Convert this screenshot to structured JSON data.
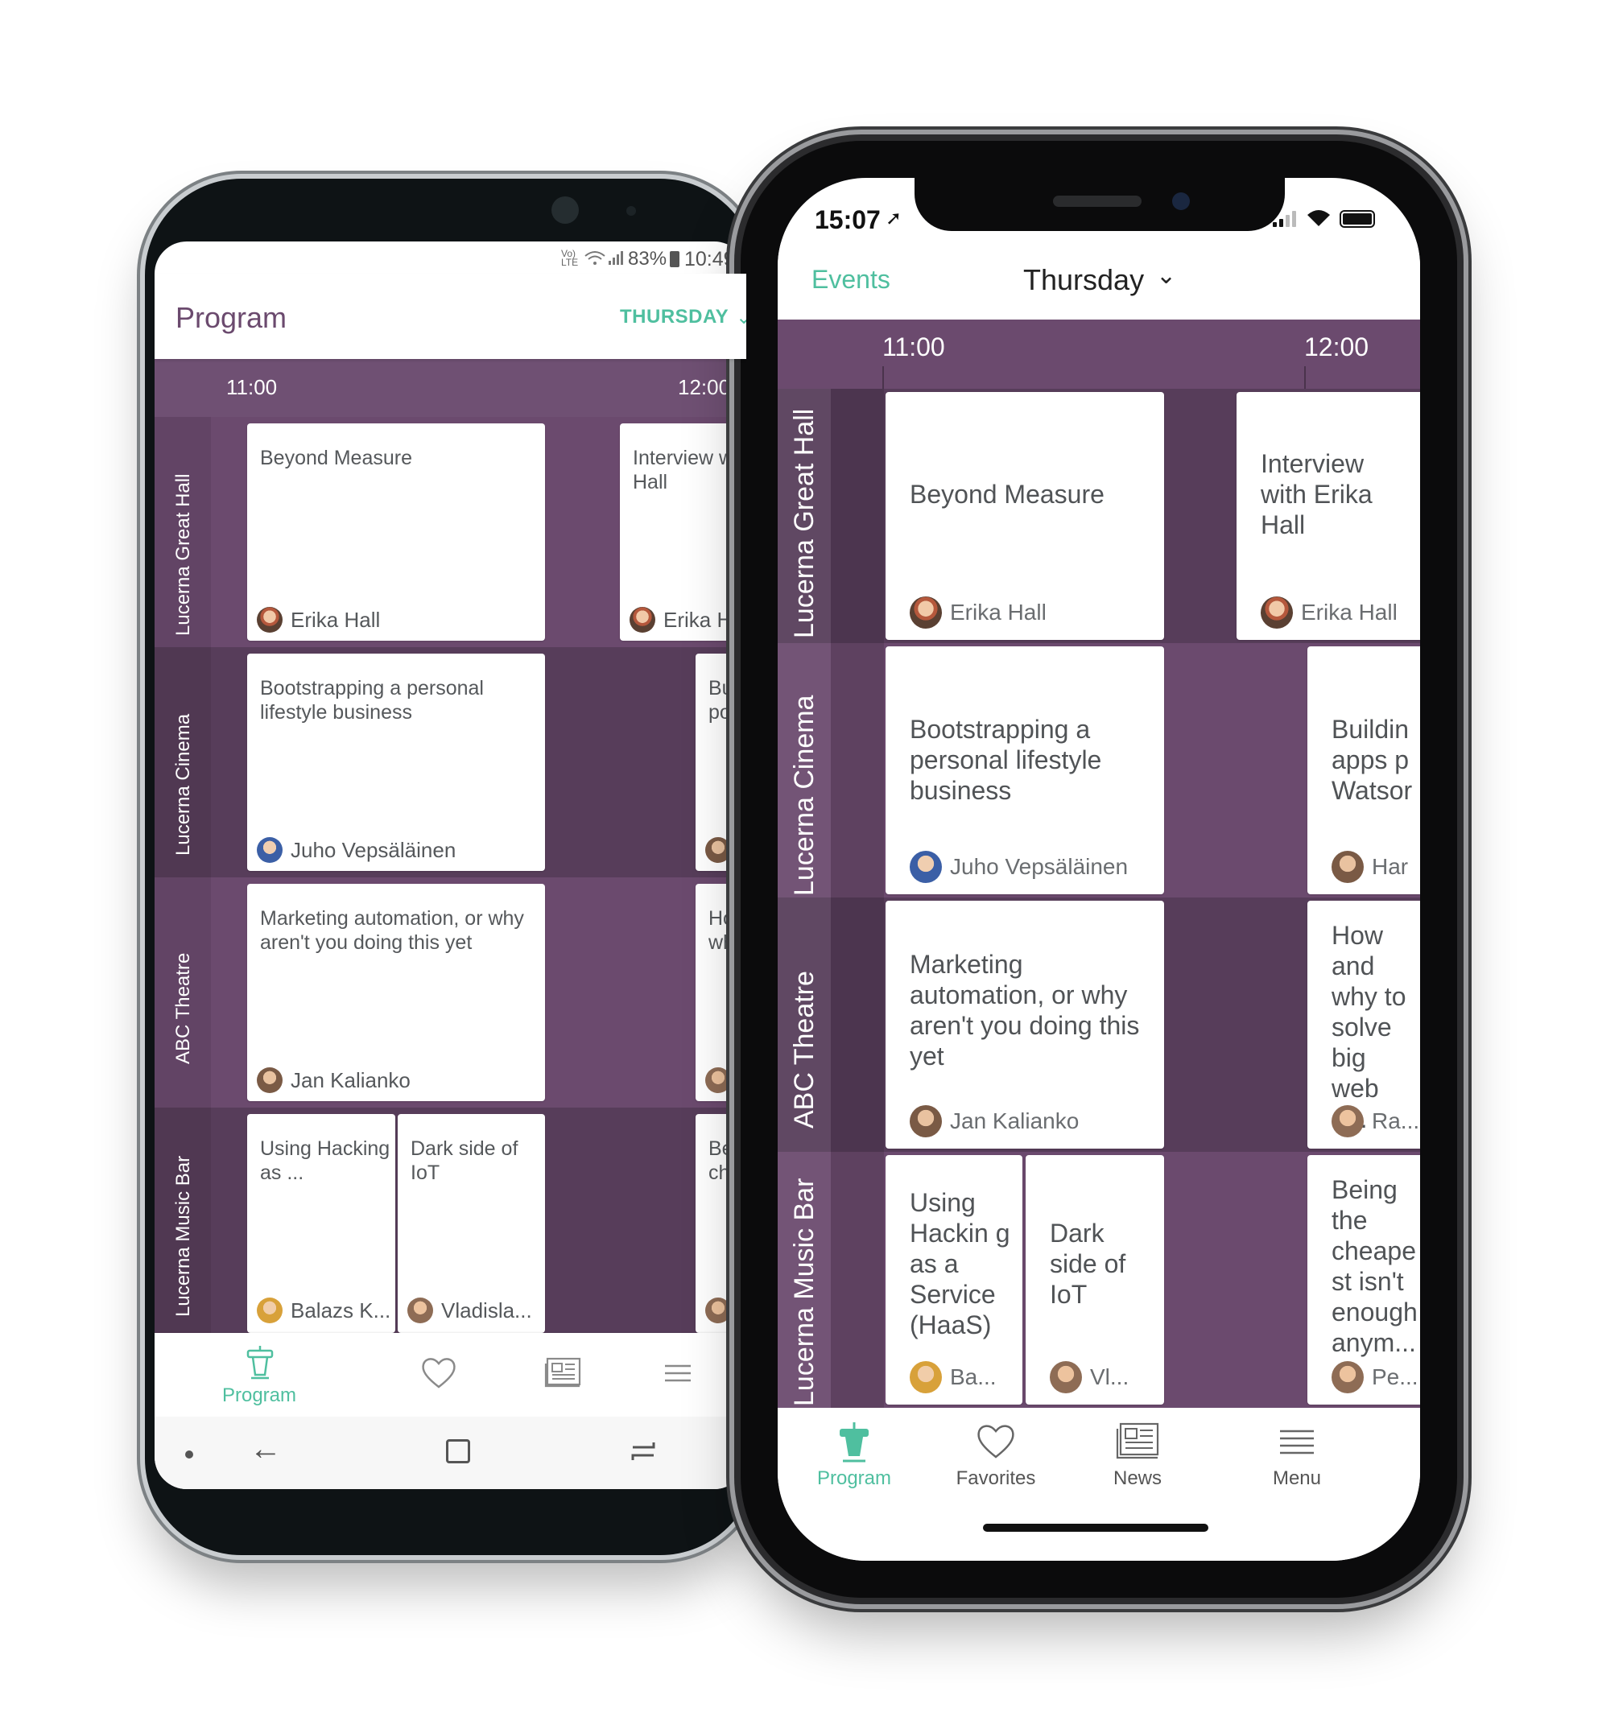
{
  "android": {
    "status": {
      "net": "Vo) LTE",
      "battery": "83%",
      "time": "10:49"
    },
    "header": {
      "title": "Program",
      "day": "THURSDAY"
    },
    "times": [
      "11:00",
      "12:00"
    ],
    "rooms": [
      "Lucerna Great Hall",
      "Lucerna Cinema",
      "ABC Theatre",
      "Lucerna Music Bar"
    ],
    "sessions": [
      {
        "title": "Beyond Measure",
        "speaker": "Erika Hall"
      },
      {
        "title": "Interview with Erika Hall",
        "title_visible": "Interview w Hall",
        "speaker": "Erika H"
      },
      {
        "title": "Bootstrapping a personal lifestyle business",
        "speaker": "Juho Vepsäläinen"
      },
      {
        "title_visible": "Bui pov"
      },
      {
        "title": "Marketing automation, or why aren't you doing this yet",
        "speaker": "Jan Kalianko"
      },
      {
        "title_visible": "Hov why"
      },
      {
        "title": "Using Hacking as ...",
        "speaker": "Balazs K..."
      },
      {
        "title": "Dark side of IoT",
        "speaker": "Vladisla..."
      },
      {
        "title_visible": "Bei che"
      }
    ],
    "tabs": [
      {
        "label": "Program"
      },
      {
        "label": ""
      },
      {
        "label": ""
      },
      {
        "label": ""
      }
    ],
    "colors": {
      "accent": "#4fbf9f",
      "purple": "#6b4a6e",
      "title": "#6b4a6e"
    }
  },
  "iphone": {
    "status": {
      "time": "15:07"
    },
    "header": {
      "back": "Events",
      "day": "Thursday"
    },
    "times": [
      "11:00",
      "12:00"
    ],
    "rooms": [
      "Lucerna Great Hall",
      "Lucerna Cinema",
      "ABC Theatre",
      "Lucerna Music Bar"
    ],
    "sessions": [
      {
        "title": "Beyond Measure",
        "speaker": "Erika Hall"
      },
      {
        "title": "Interview with Erika Hall",
        "speaker": "Erika Hall"
      },
      {
        "title": "Bootstrapping a personal lifestyle business",
        "speaker": "Juho Vepsäläinen"
      },
      {
        "title": "Buildin apps p Watsor",
        "speaker": "Har"
      },
      {
        "title": "Marketing automation, or why aren't you doing this yet",
        "speaker": "Jan Kalianko"
      },
      {
        "title": "How and why to solve big web a...",
        "speaker": "Ra..."
      },
      {
        "title": "Using Hackin g as a Service (HaaS)",
        "speaker": "Ba..."
      },
      {
        "title": "Dark side of IoT",
        "speaker": "Vl..."
      },
      {
        "title": "Being the cheape st isn't enough anym...",
        "speaker": "Pe..."
      }
    ],
    "tabs": [
      {
        "label": "Program",
        "icon": "podium-icon"
      },
      {
        "label": "Favorites",
        "icon": "heart-icon"
      },
      {
        "label": "News",
        "icon": "news-icon"
      },
      {
        "label": "Menu",
        "icon": "menu-icon"
      }
    ],
    "colors": {
      "accent": "#4fbf9f",
      "purple": "#6b4a6e"
    }
  }
}
